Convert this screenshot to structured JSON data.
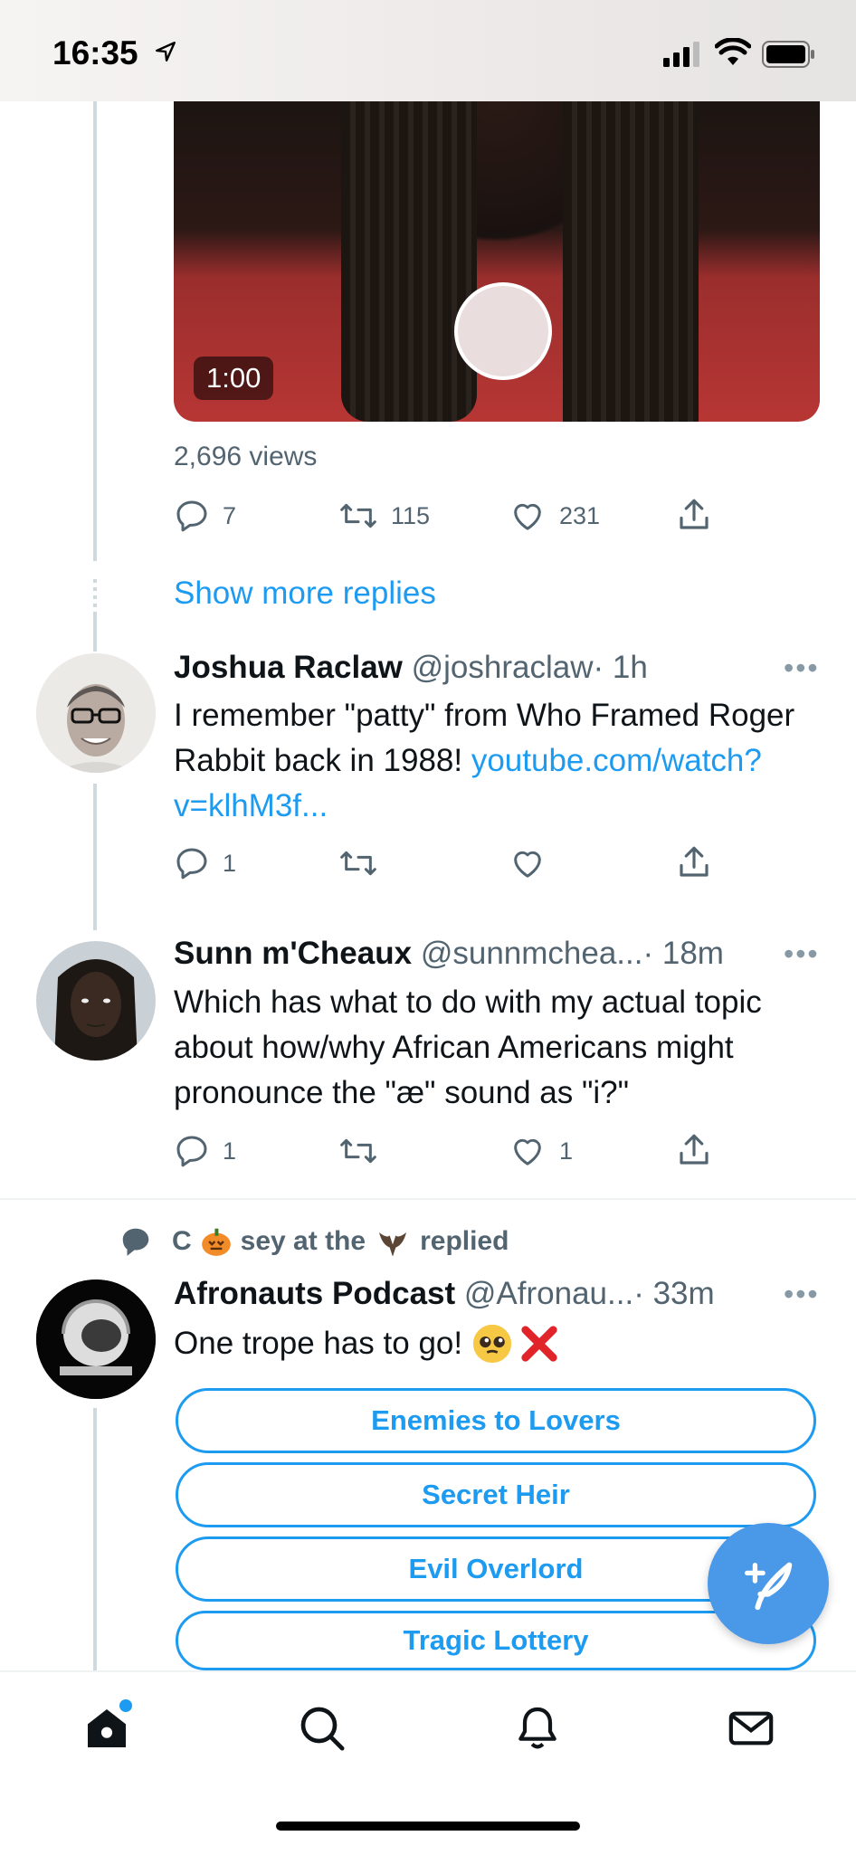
{
  "status_bar": {
    "time": "16:35"
  },
  "video": {
    "duration": "1:00"
  },
  "top_tweet": {
    "views": "2,696 views",
    "reply_count": "7",
    "retweet_count": "115",
    "like_count": "231"
  },
  "show_more": "Show more replies",
  "reply1": {
    "name": "Joshua Raclaw",
    "handle": "@joshraclaw",
    "time": "· 1h",
    "text": "I remember \"patty\" from Who Framed Roger Rabbit back in 1988! ",
    "link": "youtube.com/watch?v=klhM3f...",
    "reply_count": "1",
    "retweet_count": "",
    "like_count": ""
  },
  "reply2": {
    "name": "Sunn m'Cheaux",
    "handle": "@sunnmchea...",
    "time": "· 18m",
    "text": "Which has what to do with my actual topic about how/why African Americans might pronounce the \"æ\" sound as \"i?\"",
    "reply_count": "1",
    "retweet_count": "",
    "like_count": "1"
  },
  "social_context": {
    "text_before": "C",
    "text_after": "sey at the",
    "text_end": "replied"
  },
  "poll_tweet": {
    "name": "Afronauts Podcast",
    "handle": "@Afronau...",
    "time": "· 33m",
    "text": "One trope has to go! ",
    "options": [
      "Enemies to Lovers",
      "Secret Heir",
      "Evil Overlord",
      "Tragic Lottery"
    ]
  },
  "colors": {
    "accent": "#1d9bf0",
    "secondary_text": "#536471",
    "fab": "#4a99e9"
  },
  "icons": [
    "location-arrow-icon",
    "signal-icon",
    "wifi-icon",
    "battery-icon",
    "reply-icon",
    "retweet-icon",
    "like-icon",
    "share-icon",
    "more-icon",
    "speech-bubble-icon",
    "compose-icon",
    "home-icon",
    "search-icon",
    "notifications-icon",
    "messages-icon"
  ]
}
